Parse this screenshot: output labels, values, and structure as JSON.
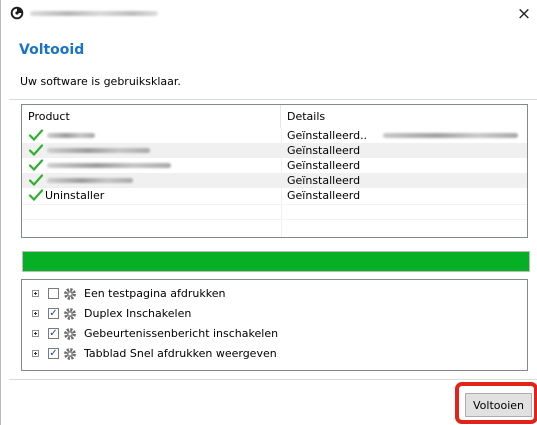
{
  "window": {
    "title_icon": "app-logo-icon",
    "close_glyph": "×"
  },
  "header": {
    "title": "Voltooid",
    "subtitle": "Uw software is gebruiksklaar."
  },
  "table": {
    "columns": [
      "Product",
      "Details"
    ],
    "rows": [
      {
        "product": "",
        "details": "Geïnstalleerd..",
        "status_icon": "check-icon"
      },
      {
        "product": "",
        "details": "Geïnstalleerd",
        "status_icon": "check-icon"
      },
      {
        "product": "",
        "details": "Geïnstalleerd",
        "status_icon": "check-icon"
      },
      {
        "product": "",
        "details": "Geïnstalleerd",
        "status_icon": "check-icon"
      },
      {
        "product": "Uninstaller",
        "details": "Geïnstalleerd",
        "status_icon": "check-icon"
      }
    ]
  },
  "progress": {
    "fraction": 1.0,
    "color": "#06b025"
  },
  "options": [
    {
      "label": "Een testpagina afdrukken",
      "checked": false
    },
    {
      "label": "Duplex Inschakelen",
      "checked": true
    },
    {
      "label": "Gebeurtenissenbericht inschakelen",
      "checked": true
    },
    {
      "label": "Tabblad Snel afdrukken weergeven",
      "checked": true
    }
  ],
  "footer": {
    "finish_label": "Voltooien"
  },
  "colors": {
    "accent": "#1a73c4",
    "check": "#2fb12f",
    "highlight": "#e2231a"
  }
}
